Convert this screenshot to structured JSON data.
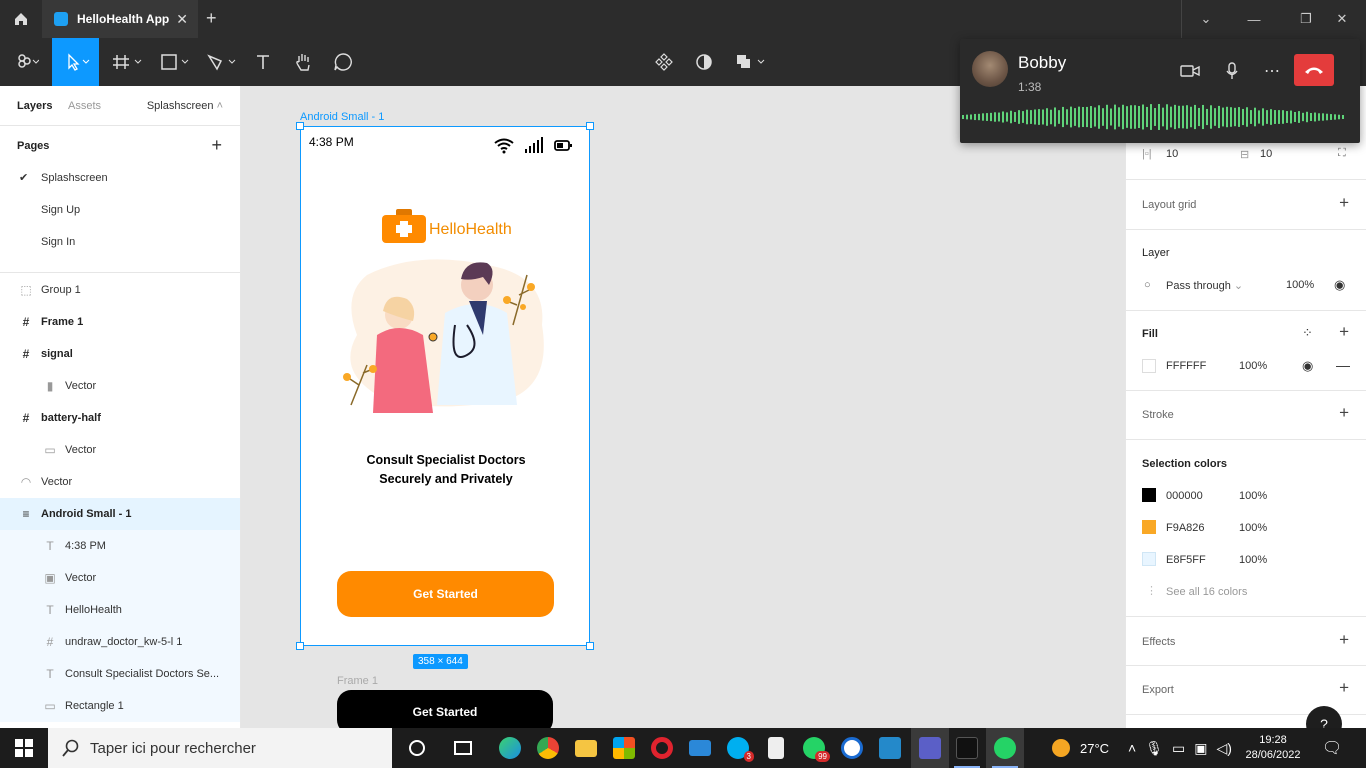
{
  "titlebar": {
    "tab_title": "HelloHealth App"
  },
  "left_panel": {
    "tabs": {
      "layers": "Layers",
      "assets": "Assets",
      "page": "Splashscreen"
    },
    "pages_label": "Pages",
    "pages": [
      "Splashscreen",
      "Sign Up",
      "Sign In"
    ],
    "layers": [
      "Group 1",
      "Frame 1",
      "signal",
      "Vector",
      "battery-half",
      "Vector",
      "Vector",
      "Android Small - 1",
      "4:38 PM",
      "Vector",
      "HelloHealth",
      "undraw_doctor_kw-5-l 1",
      "Consult Specialist Doctors Se...",
      "Rectangle 1"
    ]
  },
  "canvas": {
    "frame_label": "Android Small - 1",
    "phone": {
      "time": "4:38 PM",
      "brand": "HelloHealth",
      "headline_1": "Consult Specialist Doctors",
      "headline_2": "Securely and Privately",
      "cta": "Get Started"
    },
    "size_badge": "358 × 644",
    "frame1_label": "Frame 1",
    "frame1_button": "Get Started",
    "colors": {
      "brand_orange": "#F9A826",
      "button_orange": "#FF8A00",
      "select_blue": "#0D99FF"
    }
  },
  "right_panel": {
    "padding_h": "10",
    "padding_v": "10",
    "layout_grid": "Layout grid",
    "layer": {
      "title": "Layer",
      "blend": "Pass through",
      "opacity": "100%"
    },
    "fill": {
      "title": "Fill",
      "hex": "FFFFFF",
      "opacity": "100%"
    },
    "stroke": "Stroke",
    "selection_colors": {
      "title": "Selection colors",
      "items": [
        {
          "hex": "000000",
          "opacity": "100%",
          "color": "#000000"
        },
        {
          "hex": "F9A826",
          "opacity": "100%",
          "color": "#F9A826"
        },
        {
          "hex": "E8F5FF",
          "opacity": "100%",
          "color": "#E8F5FF"
        }
      ],
      "see_all": "See all 16 colors"
    },
    "effects": "Effects",
    "export": "Export"
  },
  "call": {
    "name": "Bobby",
    "duration": "1:38"
  },
  "taskbar": {
    "search_placeholder": "Taper ici pour rechercher",
    "skype_badge": "3",
    "whatsapp_badge": "99",
    "temperature": "27°C",
    "time": "19:28",
    "date": "28/06/2022"
  }
}
